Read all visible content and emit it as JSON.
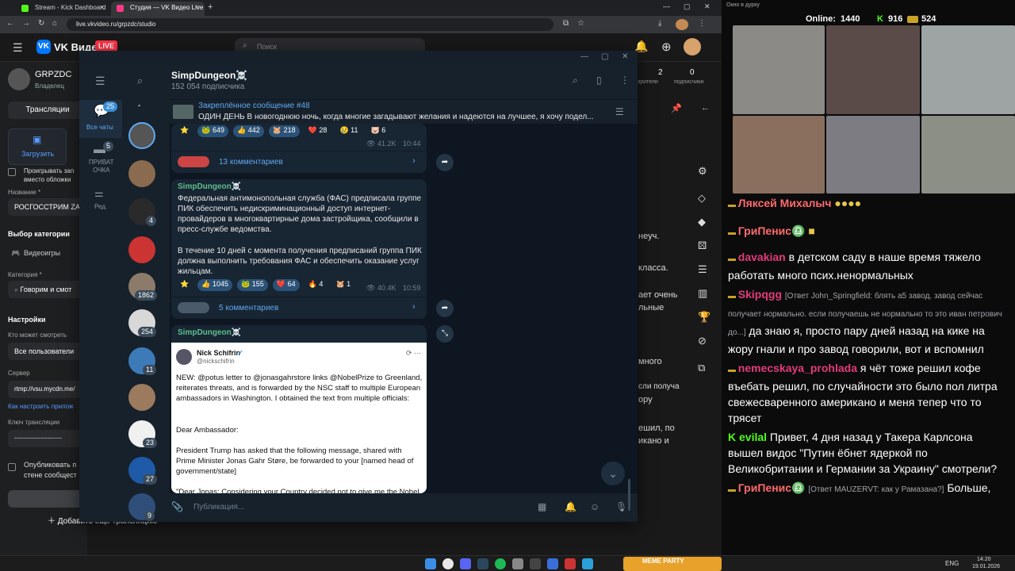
{
  "browser": {
    "tabs": [
      {
        "label": "Stream - Kick Dashboard",
        "active": false
      },
      {
        "label": "Студия — VK Видео Live",
        "active": true
      }
    ],
    "new_tab": "+",
    "url": "live.vkvideo.ru/grpzdc/studio"
  },
  "vk": {
    "logo": "VK Видео",
    "live_badge": "LIVE",
    "search_placeholder": "Поиск",
    "channel_name": "GRPZDC",
    "channel_role": "Владелец",
    "nav_broadcasts": "Трансляции",
    "upload_label": "Загрузить",
    "play_instead": "Проигрывать зап\nвместо обложки",
    "name_label": "Название *",
    "name_value": "РОСГОССТРИМ ZAV",
    "category_section": "Выбор категории",
    "category_videogames": "Видеоигры",
    "category_label": "Категория *",
    "category_value": "Говорим и смот",
    "settings_title": "Настройки",
    "who_can_watch": "Кто может смотреть",
    "who_value": "Все пользователи",
    "server_label": "Сервер",
    "server_value": "rtmp://vsu.mycdn.me/",
    "how_to": "Как настроить прилож",
    "key_label": "Ключ трансляции",
    "key_value": "--------------------",
    "publish_label": "Опубликовать п\nстене сообщест",
    "add_stream": "Добавить еще трансляцию",
    "stats": [
      {
        "value": "2",
        "label": "зрители"
      },
      {
        "value": "0",
        "label": "подписчики"
      }
    ],
    "right_fragments": [
      "неуч.",
      "класса.",
      "ает очень",
      "льные",
      "много",
      "сли получа",
      "ору",
      "ешил, по",
      "икано и"
    ]
  },
  "telegram": {
    "channel_title": "SimpDungeon☠️",
    "subscribers": "152 054 подписчика",
    "folders": [
      {
        "label": "Все чаты",
        "badge": "25"
      },
      {
        "label": "ПРИВАТ\nОЧКА",
        "badge": "5"
      },
      {
        "label": "Ред.",
        "badge": ""
      }
    ],
    "list_badges": [
      "4",
      "1862",
      "254",
      "11",
      "23",
      "27",
      "9"
    ],
    "pinned_title": "Закреплённое сообщение #48",
    "pinned_text": "ОДИН ДЕНЬ  В новогоднюю ночь, когда многие загадывают желания и надеются на лучшее, я хочу подел...",
    "post1": {
      "reactions": [
        "⭐",
        "🐸 649",
        "👍 442",
        "🐹 218",
        "❤️ 28",
        "😢 11",
        "🐷 6"
      ],
      "views": "41.2K",
      "time": "10:44",
      "comments": "13 комментариев"
    },
    "post2": {
      "author": "SimpDungeon☠️",
      "text1": "Федеральная антимонопольная служба (ФАС) предписала группе ПИК обеспечить недискриминационный доступ интернет-провайдеров в многоквартирные дома застройщика, сообщили в пресс-службе ведомства.",
      "text2": "В течение 10 дней с момента получения предписаний группа ПИК должна выполнить требования ФАС и обеспечить оказание услуг жильцам.",
      "reactions": [
        "⭐",
        "👍 1045",
        "🐸 155",
        "❤️ 64",
        "🔥 4",
        "🐹 1"
      ],
      "views": "40.4K",
      "time": "10:59",
      "comments": "5 комментариев"
    },
    "post3": {
      "author": "SimpDungeon☠️",
      "tweet_name": "Nick Schifrin",
      "tweet_handle": "@nickschifrin",
      "tweet_p1": "NEW: @potus letter to @jonasgahrstore links @NobelPrize to Greenland, reiterates threats, and is forwarded by the NSC staff to multiple European ambassadors in Washington. I obtained the text from multiple officials:",
      "tweet_p2": "Dear Ambassador:",
      "tweet_p3": "President Trump has asked that the following message, shared with Prime Minister Jonas Gahr Støre, be forwarded to your [named head of government/state]",
      "tweet_p4": "\"Dear Jonas: Considering your Country decided not to give me the Nobel"
    },
    "input_placeholder": "Публикация..."
  },
  "stream": {
    "window_title": "Окно в дурку",
    "online_label": "Online:",
    "online_value": "1440",
    "kick_count": "916",
    "other_count": "524",
    "chat": [
      {
        "nick": "Ляксей Михалыч",
        "color": "#ff6b6b",
        "reply": "",
        "text": ""
      },
      {
        "nick": "ГриПенис♎",
        "color": "#ff6b6b",
        "reply": "",
        "text": ""
      },
      {
        "nick": "davakian",
        "color": "#e23b7a",
        "reply": "",
        "text": "в детском саду в наше время тяжело работать много псих.ненормальных"
      },
      {
        "nick": "Skipqgg",
        "color": "#e23b7a",
        "reply": "[Ответ John_Springfield: блять а5 завод. завод сейчас получает нормально. если получаешь не нормально то это иван петрович до...]",
        "text": "да знаю я, просто пару дней назад на кике на жору гнали и про завод говорили, вот и вспомнил"
      },
      {
        "nick": "nemecskaya_prohlada",
        "color": "#e23b7a",
        "reply": "",
        "text": "я чёт тоже решил кофе въебать решил, по случайности это было пол литра свежесваренного американо и меня тепер что то трясет"
      },
      {
        "nick": "evilal",
        "color": "#53fc18",
        "reply": "",
        "text": "Привет, 4 дня назад у Такера Карлсона вышел видос \"Путин ёбнет ядеркой по Великобритании и Германии за Украину\" смотрели?"
      },
      {
        "nick": "ГриПенис♎",
        "color": "#ff6b6b",
        "reply": "[Ответ MAUZERVT: как у Рамазана?]",
        "text": "Больше,"
      }
    ]
  },
  "taskbar": {
    "lang": "ENG",
    "time": "14:20",
    "date": "19.01.2026",
    "widget_title": "MEME PARTY"
  }
}
